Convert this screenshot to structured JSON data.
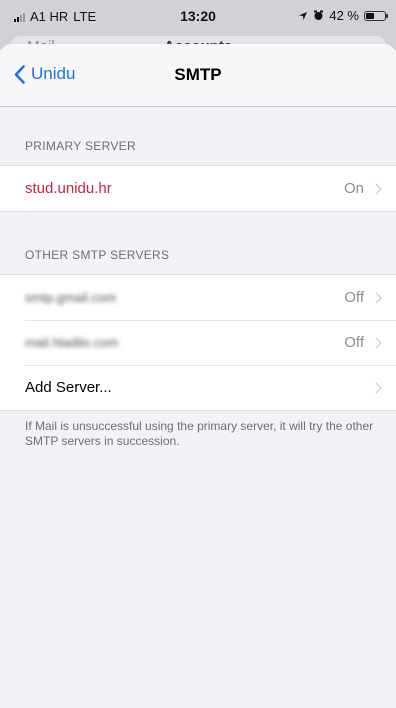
{
  "status_bar": {
    "carrier": "A1 HR",
    "network": "LTE",
    "time": "13:20",
    "battery_text": "42 %",
    "battery_level": 0.42
  },
  "previous_screen": {
    "back_label": "Mail",
    "title": "Accounts"
  },
  "nav": {
    "back_label": "Unidu",
    "title": "SMTP"
  },
  "primary_section": {
    "header": "PRIMARY SERVER",
    "rows": [
      {
        "label": "stud.unidu.hr",
        "value": "On"
      }
    ]
  },
  "other_section": {
    "header": "OTHER SMTP SERVERS",
    "rows": [
      {
        "label": "smtp.gmail.com",
        "value": "Off"
      },
      {
        "label": "mail.hladilo.com",
        "value": "Off"
      },
      {
        "label": "Add Server...",
        "value": ""
      }
    ]
  },
  "footer_note": "If Mail is unsuccessful using the primary server, it will try the other SMTP servers in succession.",
  "colors": {
    "accent": "#1a73e8",
    "primary_server": "#c8224a"
  },
  "icons": [
    "signal-icon",
    "location-arrow-icon",
    "alarm-icon",
    "battery-icon",
    "chevron-left-icon",
    "chevron-right-icon"
  ]
}
